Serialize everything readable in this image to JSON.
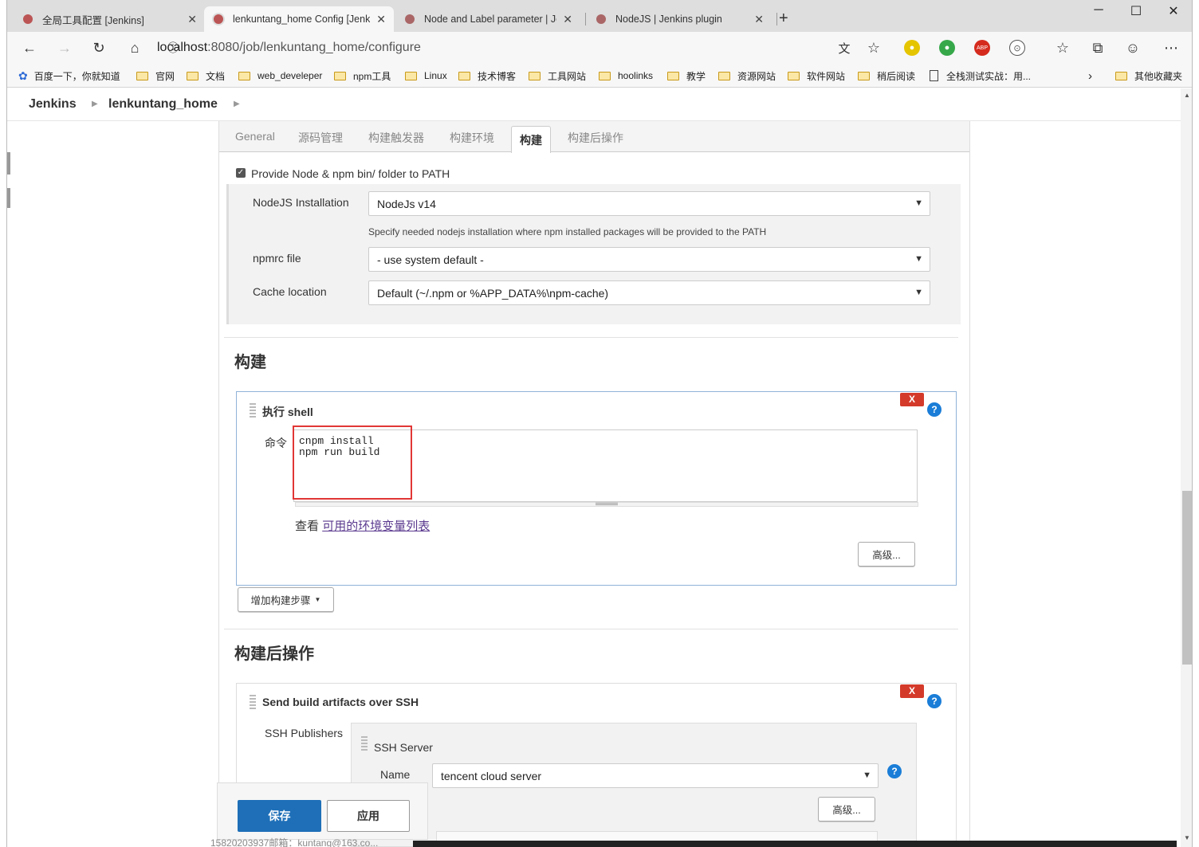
{
  "browser": {
    "tabs": [
      {
        "title": "全局工具配置 [Jenkins]",
        "active": false
      },
      {
        "title": "lenkuntang_home Config [Jenkins]",
        "active": true
      },
      {
        "title": "Node and Label parameter | Jenkins plugin",
        "active": false
      },
      {
        "title": "NodeJS | Jenkins plugin",
        "active": false
      }
    ],
    "new_tab": "+",
    "url_host": "localhost",
    "url_path": ":8080/job/lenkuntang_home/configure",
    "bookmarks": [
      "百度一下，你就知道",
      "官网",
      "文档",
      "web_develeper",
      "npm工具",
      "Linux",
      "技术博客",
      "工具网站",
      "hoolinks",
      "教学",
      "资源网站",
      "软件网站",
      "稍后阅读",
      "全栈测试实战：用...",
      "其他收藏夹"
    ]
  },
  "breadcrumb": {
    "root": "Jenkins",
    "job": "lenkuntang_home"
  },
  "config_tabs": [
    "General",
    "源码管理",
    "构建触发器",
    "构建环境",
    "构建",
    "构建后操作"
  ],
  "active_config_tab": "构建",
  "node_env": {
    "checkbox_label": "Provide Node & npm bin/ folder to PATH",
    "checked": true,
    "nodejs_label": "NodeJS Installation",
    "nodejs_value": "NodeJs v14",
    "nodejs_hint": "Specify needed nodejs installation where npm installed packages will be provided to the PATH",
    "npmrc_label": "npmrc file",
    "npmrc_value": "- use system default -",
    "cache_label": "Cache location",
    "cache_value": "Default (~/.npm or %APP_DATA%\\npm-cache)"
  },
  "build": {
    "section_title": "构建",
    "step_title": "执行 shell",
    "command_label": "命令",
    "command": "cnpm install\nnpm run build",
    "env_prefix": "查看",
    "env_link": "可用的环境变量列表",
    "advanced": "高级...",
    "add_step": "增加构建步骤",
    "delete": "X",
    "help": "?"
  },
  "post_build": {
    "section_title": "构建后操作",
    "step_title": "Send build artifacts over SSH",
    "publishers_label": "SSH Publishers",
    "server_title": "SSH Server",
    "name_label": "Name",
    "name_value": "tencent cloud server",
    "advanced": "高级...",
    "delete": "X",
    "help": "?"
  },
  "footer": {
    "save": "保存",
    "apply": "应用",
    "partial_text": "15820203937邮箱：kuntang@163.co..."
  },
  "colors": {
    "primary_button": "#1e6fb8",
    "delete_red": "#d43a2a",
    "help_blue": "#1a7dd7",
    "highlight_box": "#e23636"
  }
}
